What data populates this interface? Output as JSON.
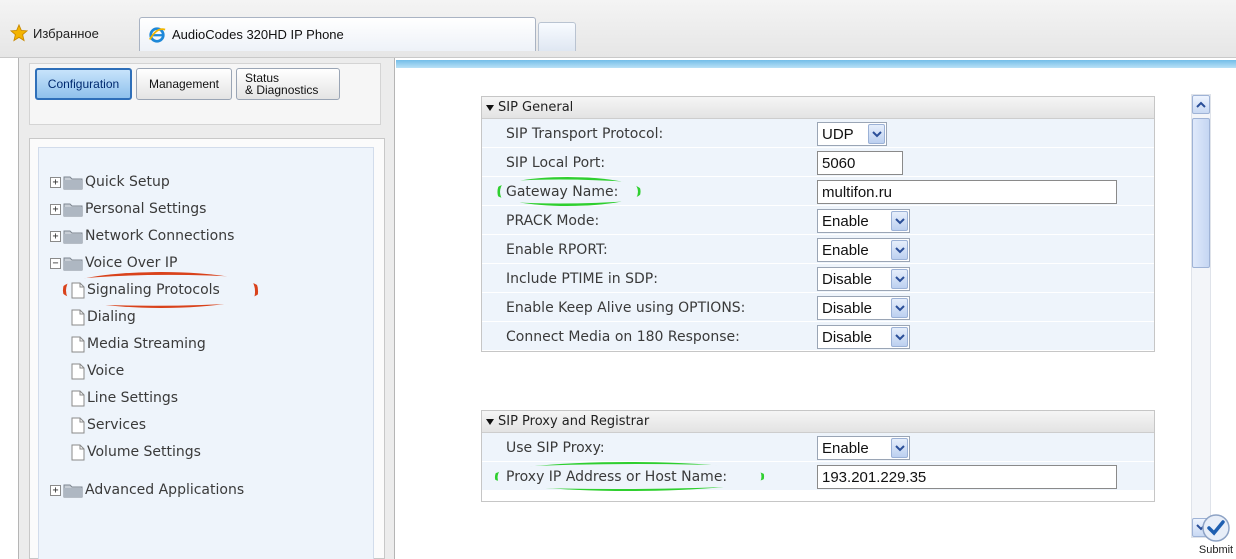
{
  "browser": {
    "favorites_label": "Избранное",
    "tab_title": "AudioCodes 320HD IP Phone"
  },
  "top_nav": {
    "configuration": "Configuration",
    "management": "Management",
    "status_line1": "Status",
    "status_line2": "& Diagnostics"
  },
  "tree": {
    "quick_setup": "Quick Setup",
    "personal_settings": "Personal Settings",
    "network_connections": "Network Connections",
    "voice_over_ip": "Voice Over IP",
    "signaling_protocols": "Signaling Protocols",
    "dialing": "Dialing",
    "media_streaming": "Media Streaming",
    "voice": "Voice",
    "line_settings": "Line Settings",
    "services": "Services",
    "volume_settings": "Volume Settings",
    "advanced_applications": "Advanced Applications"
  },
  "sip_general": {
    "title": "SIP General",
    "transport_label": "SIP Transport Protocol:",
    "transport_value": "UDP",
    "local_port_label": "SIP Local Port:",
    "local_port_value": "5060",
    "gateway_label": "Gateway Name:",
    "gateway_value": "multifon.ru",
    "prack_label": "PRACK Mode:",
    "prack_value": "Enable",
    "rport_label": "Enable RPORT:",
    "rport_value": "Enable",
    "ptime_label": "Include PTIME in SDP:",
    "ptime_value": "Disable",
    "keepalive_label": "Enable Keep Alive using OPTIONS:",
    "keepalive_value": "Disable",
    "connect180_label": "Connect Media on 180 Response:",
    "connect180_value": "Disable"
  },
  "sip_proxy": {
    "title": "SIP Proxy and Registrar",
    "use_proxy_label": "Use SIP Proxy:",
    "use_proxy_value": "Enable",
    "proxy_ip_label": "Proxy IP Address or Host Name:",
    "proxy_ip_value": "193.201.229.35"
  },
  "submit_label": "Submit",
  "colors": {
    "highlight_red": "#d9421b",
    "highlight_green": "#2fcf2f",
    "accent_blue": "#2e6fb9"
  }
}
